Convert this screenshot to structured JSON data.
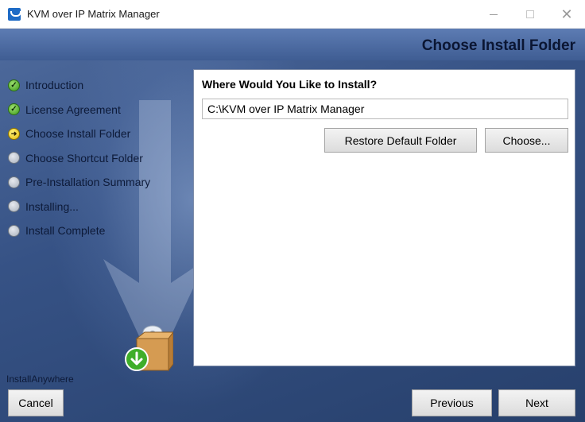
{
  "window": {
    "title": "KVM over IP Matrix Manager",
    "minimize_icon": "minimize-icon",
    "maximize_icon": "maximize-icon",
    "close_icon": "close-icon"
  },
  "header": {
    "title": "Choose Install Folder"
  },
  "steps": [
    {
      "label": "Introduction",
      "state": "done"
    },
    {
      "label": "License Agreement",
      "state": "done"
    },
    {
      "label": "Choose Install Folder",
      "state": "current"
    },
    {
      "label": "Choose Shortcut Folder",
      "state": "pending"
    },
    {
      "label": "Pre-Installation Summary",
      "state": "pending"
    },
    {
      "label": "Installing...",
      "state": "pending"
    },
    {
      "label": "Install Complete",
      "state": "pending"
    }
  ],
  "brand": "InstallAnywhere",
  "content": {
    "question": "Where Would You Like to Install?",
    "install_path": "C:\\KVM over IP Matrix Manager",
    "restore_label": "Restore Default Folder",
    "choose_label": "Choose..."
  },
  "footer": {
    "cancel_label": "Cancel",
    "previous_label": "Previous",
    "next_label": "Next"
  },
  "colors": {
    "header_gradient_top": "#5d7cb3",
    "background_dark": "#27406c",
    "done_icon": "#3d9a1c",
    "current_icon": "#e3b90c",
    "pending_icon": "#a9b1bd"
  }
}
